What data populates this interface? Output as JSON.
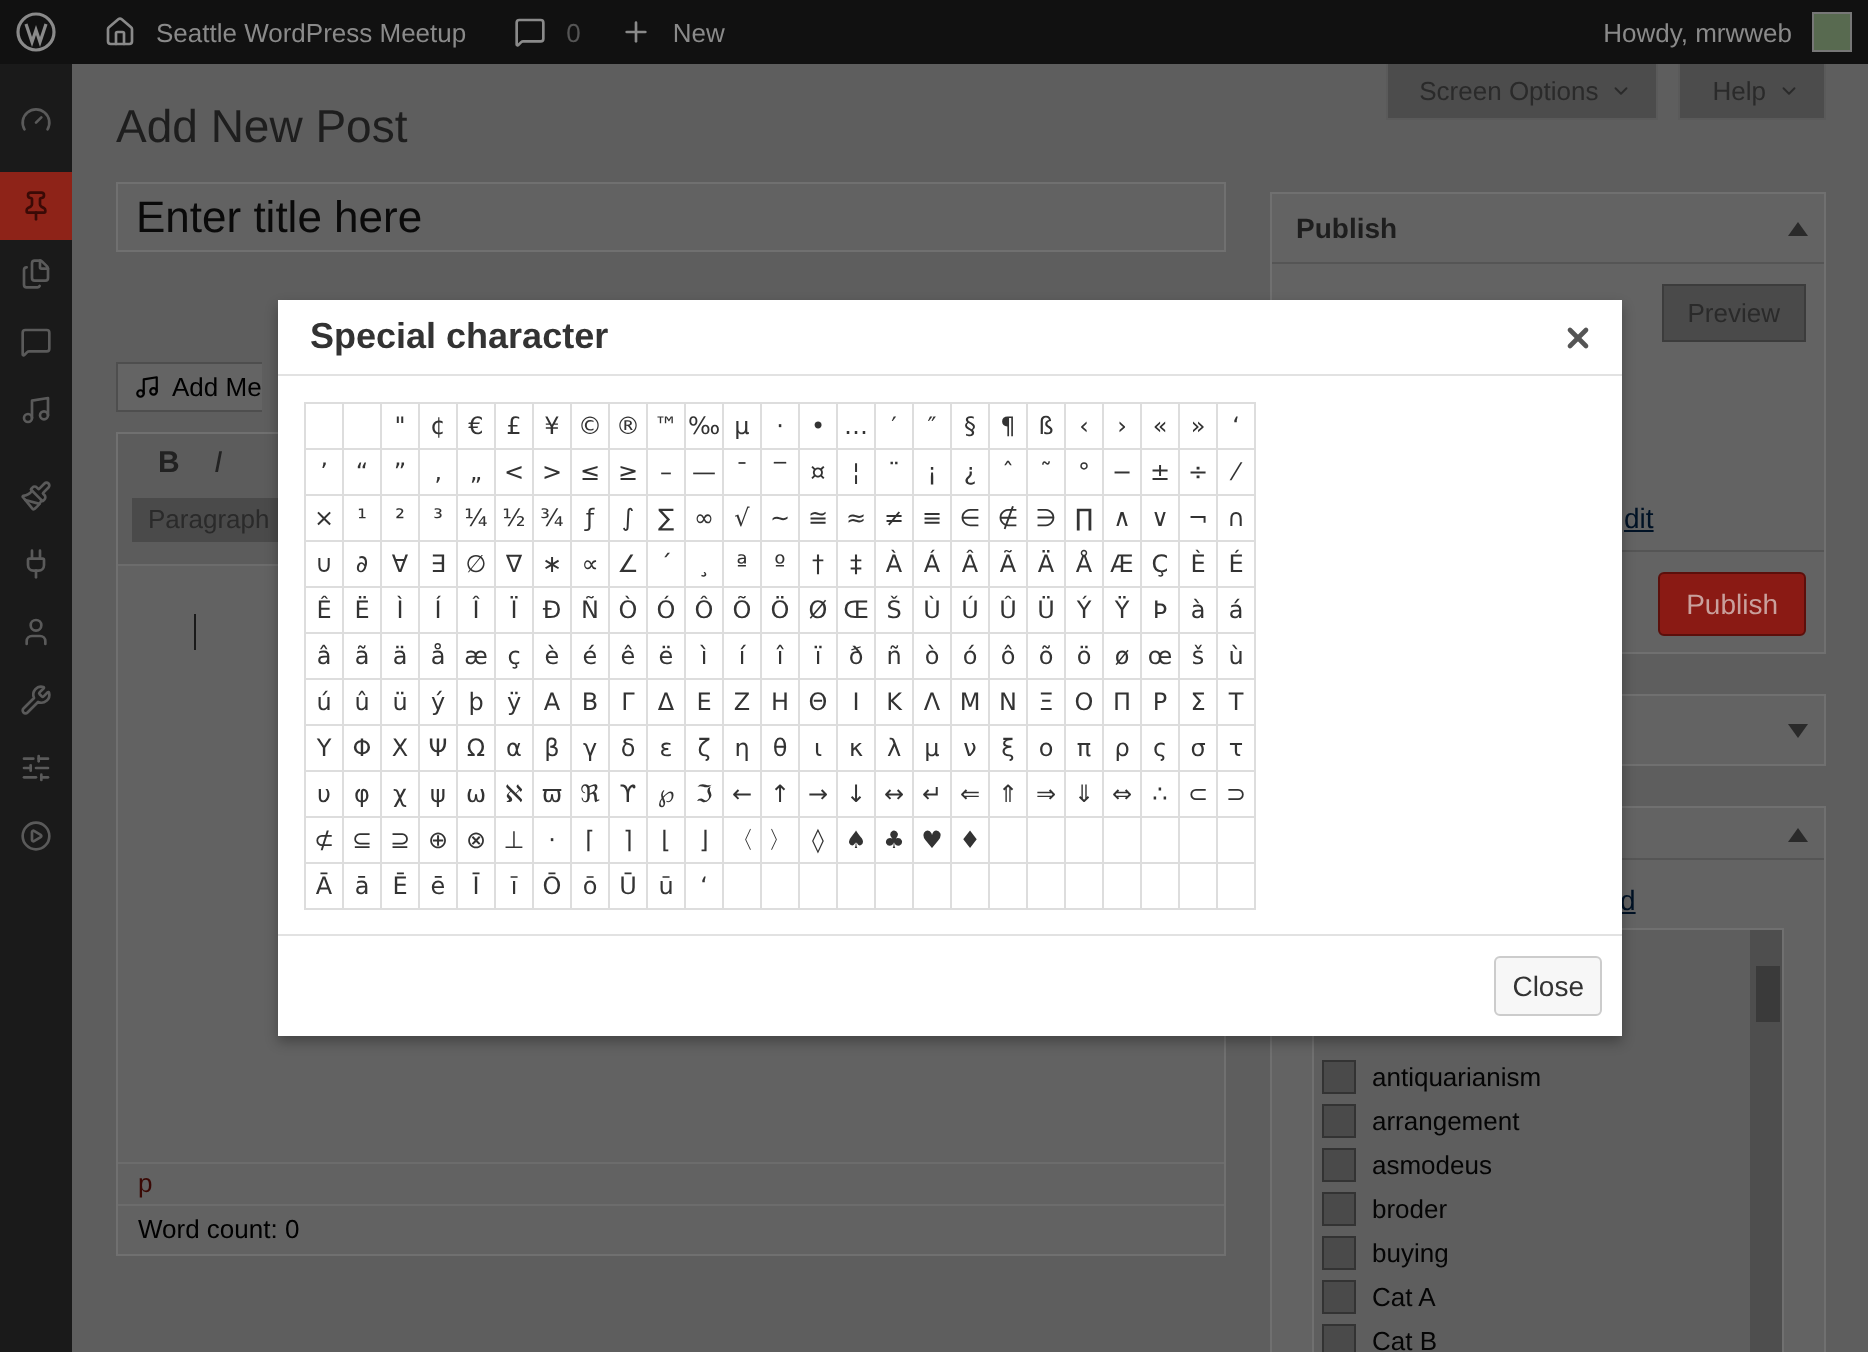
{
  "admin_bar": {
    "site_name": "Seattle WordPress Meetup",
    "comments": "0",
    "new_label": "New",
    "greeting": "Howdy, mrwweb"
  },
  "sidebar": {
    "items": [
      {
        "selected": false
      },
      {
        "selected": true
      },
      {
        "selected": false
      },
      {
        "selected": false
      },
      {
        "selected": false
      },
      {
        "selected": false
      },
      {
        "selected": false
      },
      {
        "selected": false
      },
      {
        "selected": false
      },
      {
        "selected": false
      },
      {
        "selected": false
      }
    ]
  },
  "screen_meta": [
    "Screen Options",
    "Help"
  ],
  "page_title": "Add New Post",
  "title_field": {
    "placeholder": "Enter title here"
  },
  "media_button": "Add Me",
  "editor": {
    "toolbar": [
      "B",
      "I"
    ],
    "format_select": "Paragraph",
    "path": "p",
    "word_count": "Word count: 0"
  },
  "publish_box": {
    "title": "Publish",
    "expanded": true,
    "preview": "Preview",
    "edit_link": "dit",
    "publish": "Publish"
  },
  "collapsed_box": {
    "expanded": false
  },
  "categories_box": {
    "expanded": true,
    "tab_link": "d",
    "items": [
      {
        "label": "antiquarianism",
        "checked": false
      },
      {
        "label": "arrangement",
        "checked": false
      },
      {
        "label": "asmodeus",
        "checked": false
      },
      {
        "label": "broder",
        "checked": false
      },
      {
        "label": "buying",
        "checked": false
      },
      {
        "label": "Cat A",
        "checked": false
      },
      {
        "label": "Cat B",
        "checked": false
      }
    ]
  },
  "dialog": {
    "title": "Special character",
    "close_button": "Close",
    "characters": [
      {
        "blank_first": true,
        "cells": [
          "\"",
          "¢",
          "€",
          "£",
          "¥",
          "©",
          "®",
          "™",
          "‰",
          "µ",
          "·",
          "•",
          "…",
          "′",
          "″",
          "§",
          "¶",
          "ß",
          "‹",
          "›",
          "«",
          "»",
          "‘"
        ]
      },
      {
        "blank_first": false,
        "cells": [
          "’",
          "“",
          "”",
          "‚",
          "„",
          "<",
          ">",
          "≤",
          "≥",
          "–",
          "—",
          "¯",
          "‾",
          "¤",
          "¦",
          "¨",
          "¡",
          "¿",
          "ˆ",
          "˜",
          "°",
          "−",
          "±",
          "÷",
          "⁄"
        ]
      },
      {
        "blank_first": false,
        "cells": [
          "×",
          "¹",
          "²",
          "³",
          "¼",
          "½",
          "¾",
          "ƒ",
          "∫",
          "∑",
          "∞",
          "√",
          "∼",
          "≅",
          "≈",
          "≠",
          "≡",
          "∈",
          "∉",
          "∋",
          "∏",
          "∧",
          "∨",
          "¬",
          "∩"
        ]
      },
      {
        "blank_first": false,
        "cells": [
          "∪",
          "∂",
          "∀",
          "∃",
          "∅",
          "∇",
          "∗",
          "∝",
          "∠",
          "´",
          "¸",
          "ª",
          "º",
          "†",
          "‡",
          "À",
          "Á",
          "Â",
          "Ã",
          "Ä",
          "Å",
          "Æ",
          "Ç",
          "È",
          "É"
        ]
      },
      {
        "blank_first": false,
        "cells": [
          "Ê",
          "Ë",
          "Ì",
          "Í",
          "Î",
          "Ï",
          "Ð",
          "Ñ",
          "Ò",
          "Ó",
          "Ô",
          "Õ",
          "Ö",
          "Ø",
          "Œ",
          "Š",
          "Ù",
          "Ú",
          "Û",
          "Ü",
          "Ý",
          "Ÿ",
          "Þ",
          "à",
          "á"
        ]
      },
      {
        "blank_first": false,
        "cells": [
          "â",
          "ã",
          "ä",
          "å",
          "æ",
          "ç",
          "è",
          "é",
          "ê",
          "ë",
          "ì",
          "í",
          "î",
          "ï",
          "ð",
          "ñ",
          "ò",
          "ó",
          "ô",
          "õ",
          "ö",
          "ø",
          "œ",
          "š",
          "ù"
        ]
      },
      {
        "blank_first": false,
        "cells": [
          "ú",
          "û",
          "ü",
          "ý",
          "þ",
          "ÿ",
          "Α",
          "Β",
          "Γ",
          "Δ",
          "Ε",
          "Ζ",
          "Η",
          "Θ",
          "Ι",
          "Κ",
          "Λ",
          "Μ",
          "Ν",
          "Ξ",
          "Ο",
          "Π",
          "Ρ",
          "Σ",
          "Τ"
        ]
      },
      {
        "blank_first": false,
        "cells": [
          "Υ",
          "Φ",
          "Χ",
          "Ψ",
          "Ω",
          "α",
          "β",
          "γ",
          "δ",
          "ε",
          "ζ",
          "η",
          "θ",
          "ι",
          "κ",
          "λ",
          "μ",
          "ν",
          "ξ",
          "ο",
          "π",
          "ρ",
          "ς",
          "σ",
          "τ"
        ]
      },
      {
        "blank_first": false,
        "cells": [
          "υ",
          "φ",
          "χ",
          "ψ",
          "ω",
          "ℵ",
          "ϖ",
          "ℜ",
          "ϒ",
          "℘",
          "ℑ",
          "←",
          "↑",
          "→",
          "↓",
          "↔",
          "↵",
          "⇐",
          "⇑",
          "⇒",
          "⇓",
          "⇔",
          "∴",
          "⊂",
          "⊃"
        ]
      },
      {
        "blank_first": false,
        "cells": [
          "⊄",
          "⊆",
          "⊇",
          "⊕",
          "⊗",
          "⊥",
          "⋅",
          "⌈",
          "⌉",
          "⌊",
          "⌋",
          "〈",
          "〉",
          "◊",
          "♠",
          "♣",
          "♥",
          "♦"
        ]
      },
      {
        "blank_first": false,
        "cells": [
          "Ā",
          "ā",
          "Ē",
          "ē",
          "Ī",
          "ī",
          "Ō",
          "ō",
          "Ū",
          "ū",
          "ʻ"
        ]
      }
    ]
  }
}
